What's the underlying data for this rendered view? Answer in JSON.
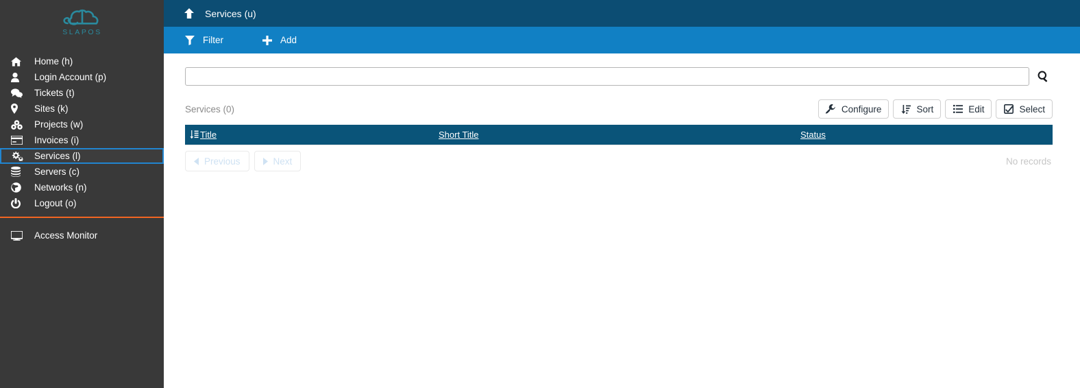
{
  "brand": {
    "name": "SLAPOS",
    "logo_icon": "cloud-logo-icon",
    "accent_color": "#2a8a9e",
    "sidebar_bg": "#393939",
    "divider_color": "#f26522"
  },
  "sidebar": {
    "items": [
      {
        "label": "Home (h)",
        "icon": "home-icon",
        "active": false
      },
      {
        "label": "Login Account (p)",
        "icon": "user-icon",
        "active": false
      },
      {
        "label": "Tickets (t)",
        "icon": "comments-icon",
        "active": false
      },
      {
        "label": "Sites (k)",
        "icon": "map-marker-icon",
        "active": false
      },
      {
        "label": "Projects (w)",
        "icon": "cubes-icon",
        "active": false
      },
      {
        "label": "Invoices (i)",
        "icon": "credit-card-icon",
        "active": false
      },
      {
        "label": "Services (l)",
        "icon": "cogs-icon",
        "active": true
      },
      {
        "label": "Servers (c)",
        "icon": "database-icon",
        "active": false
      },
      {
        "label": "Networks (n)",
        "icon": "globe-icon",
        "active": false
      },
      {
        "label": "Logout (o)",
        "icon": "power-off-icon",
        "active": false
      }
    ],
    "bottom_items": [
      {
        "label": "Access Monitor",
        "icon": "desktop-icon"
      }
    ]
  },
  "topbar": {
    "up_icon": "arrow-up-icon",
    "title": "Services (u)",
    "bg_color": "#0c4d73"
  },
  "toolbar": {
    "bg_color": "#1180c4",
    "buttons": [
      {
        "label": "Filter",
        "icon": "filter-icon"
      },
      {
        "label": "Add",
        "icon": "plus-icon"
      }
    ]
  },
  "search": {
    "value": "",
    "placeholder": "",
    "icon": "search-icon"
  },
  "list": {
    "count_label": "Services (0)",
    "actions": [
      {
        "label": "Configure",
        "icon": "wrench-icon"
      },
      {
        "label": "Sort",
        "icon": "sort-amount-down-icon"
      },
      {
        "label": "Edit",
        "icon": "list-icon"
      },
      {
        "label": "Select",
        "icon": "check-square-icon"
      }
    ],
    "columns": [
      {
        "label": "Title",
        "sort_icon": "sort-alpha-down-icon"
      },
      {
        "label": "Short Title",
        "sort_icon": ""
      },
      {
        "label": "Status",
        "sort_icon": ""
      }
    ],
    "rows": [],
    "empty_message": "No records",
    "header_bg": "#0a5479"
  },
  "pagination": {
    "previous_label": "Previous",
    "previous_icon": "caret-left-icon",
    "previous_disabled": true,
    "next_label": "Next",
    "next_icon": "caret-right-icon",
    "next_disabled": true
  }
}
